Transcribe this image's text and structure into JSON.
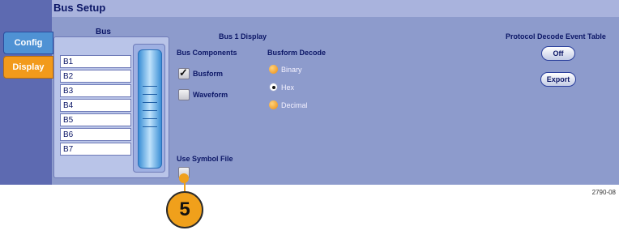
{
  "window": {
    "title": "Bus Setup"
  },
  "tabs": [
    {
      "label": "Config"
    },
    {
      "label": "Display"
    }
  ],
  "bus_list": {
    "header": "Bus",
    "items": [
      "B1",
      "B2",
      "B3",
      "B4",
      "B5",
      "B6",
      "B7"
    ]
  },
  "display": {
    "header": "Bus 1 Display",
    "components": {
      "header": "Bus Components",
      "busform": {
        "label": "Busform",
        "checked": true
      },
      "waveform": {
        "label": "Waveform",
        "checked": false
      }
    },
    "decode": {
      "header": "Busform Decode",
      "options": [
        {
          "label": "Binary",
          "selected": false
        },
        {
          "label": "Hex",
          "selected": true
        },
        {
          "label": "Decimal",
          "selected": false
        }
      ]
    },
    "symbol": {
      "label": "Use Symbol File",
      "checked": false
    }
  },
  "protocol": {
    "header": "Protocol Decode Event Table",
    "off_label": "Off",
    "export_label": "Export"
  },
  "figure_id": "2790-08",
  "callout": "5",
  "colors": {
    "panel": "#8d9bcc",
    "title_text": "#0b1666",
    "tab_active": "#f29a1b",
    "tab_inactive": "#4f92d4",
    "callout": "#f0a01b"
  }
}
